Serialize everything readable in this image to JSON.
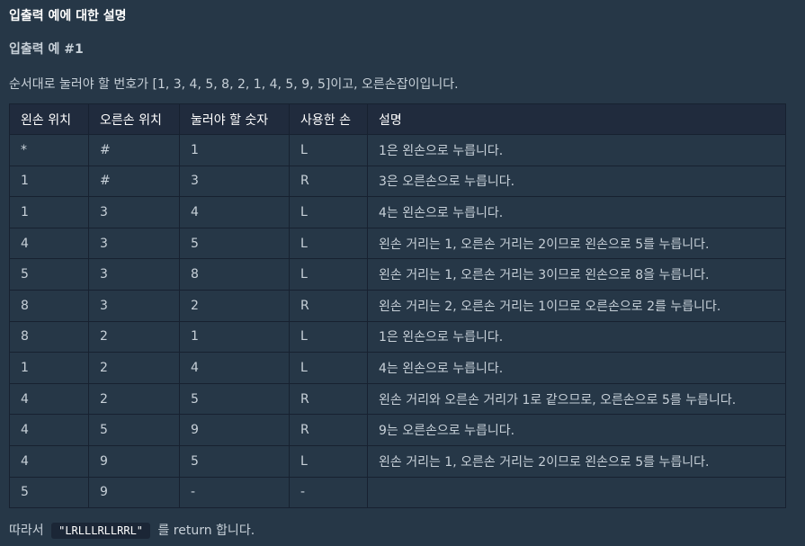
{
  "section_title": "입출력 예에 대한 설명",
  "example_title": "입출력 예 #1",
  "description": "순서대로 눌러야 할 번호가 [1, 3, 4, 5, 8, 2, 1, 4, 5, 9, 5]이고, 오른손잡이입니다.",
  "table": {
    "headers": [
      "왼손 위치",
      "오른손 위치",
      "눌러야 할 숫자",
      "사용한 손",
      "설명"
    ],
    "rows": [
      [
        "*",
        "#",
        "1",
        "L",
        "1은 왼손으로 누릅니다."
      ],
      [
        "1",
        "#",
        "3",
        "R",
        "3은 오른손으로 누릅니다."
      ],
      [
        "1",
        "3",
        "4",
        "L",
        "4는 왼손으로 누릅니다."
      ],
      [
        "4",
        "3",
        "5",
        "L",
        "왼손 거리는 1, 오른손 거리는 2이므로 왼손으로 5를 누릅니다."
      ],
      [
        "5",
        "3",
        "8",
        "L",
        "왼손 거리는 1, 오른손 거리는 3이므로 왼손으로 8을 누릅니다."
      ],
      [
        "8",
        "3",
        "2",
        "R",
        "왼손 거리는 2, 오른손 거리는 1이므로 오른손으로 2를 누릅니다."
      ],
      [
        "8",
        "2",
        "1",
        "L",
        "1은 왼손으로 누릅니다."
      ],
      [
        "1",
        "2",
        "4",
        "L",
        "4는 왼손으로 누릅니다."
      ],
      [
        "4",
        "2",
        "5",
        "R",
        "왼손 거리와 오른손 거리가 1로 같으므로, 오른손으로 5를 누릅니다."
      ],
      [
        "4",
        "5",
        "9",
        "R",
        "9는 오른손으로 누릅니다."
      ],
      [
        "4",
        "9",
        "5",
        "L",
        "왼손 거리는 1, 오른손 거리는 2이므로 왼손으로 5를 누릅니다."
      ],
      [
        "5",
        "9",
        "-",
        "-",
        ""
      ]
    ]
  },
  "footer": {
    "prefix": "따라서",
    "code": "\"LRLLLRLLRRL\"",
    "suffix": "를 return 합니다."
  }
}
